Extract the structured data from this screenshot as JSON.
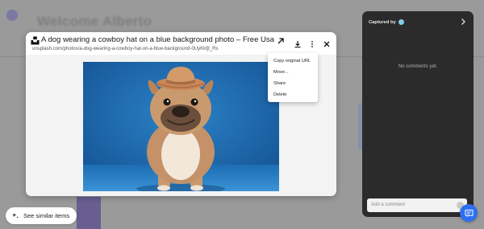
{
  "background": {
    "title": "Welcome Alberto"
  },
  "preview": {
    "title": "A dog wearing a cowboy hat on a blue background photo – Free Usa I...",
    "url": "unsplash.com/photos/a-dog-wearing-a-cowboy-hat-on-a-blue-background-0UyKkfjt_Rs",
    "icons": [
      "open-external-icon",
      "download-icon",
      "more-options-icon",
      "close-icon"
    ]
  },
  "menu": {
    "items": [
      {
        "label": "Copy original URL"
      },
      {
        "label": "Move..."
      },
      {
        "label": "Share"
      },
      {
        "label": "Delete"
      }
    ]
  },
  "panel": {
    "captured_by": "Captured by",
    "empty_text": "No comments yet.",
    "comment_placeholder": "Add a comment"
  },
  "similar": {
    "label": "See similar items"
  },
  "colors": {
    "accent": "#2d6ff0",
    "panel_bg": "#2b2b2b",
    "photo_bg": "#1f6fb8"
  }
}
